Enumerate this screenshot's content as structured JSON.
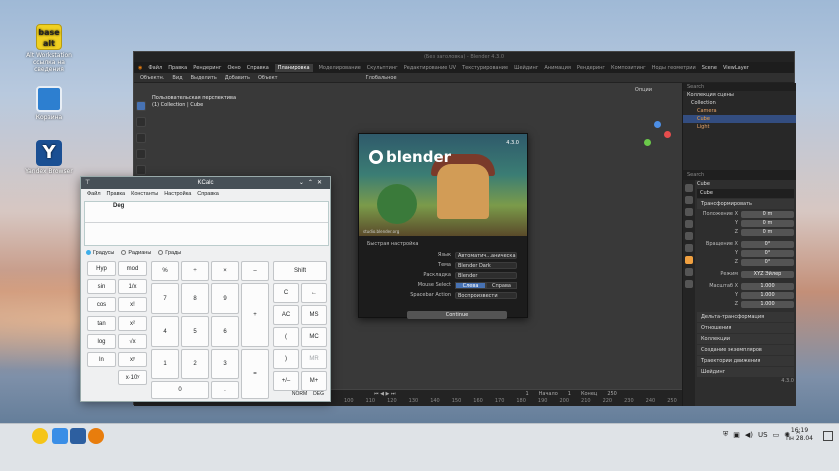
{
  "desktop": {
    "icons": [
      {
        "label": "Alt Workstation\nссылка на\nсведения",
        "badge": "base alt"
      },
      {
        "label": "Корзина"
      },
      {
        "label": "Yandex Browser"
      }
    ]
  },
  "blender": {
    "title": "(Без заголовка) - Blender 4.3.0",
    "menu": [
      "Файл",
      "Правка",
      "Рендеринг",
      "Окно",
      "Справка"
    ],
    "workspaces": [
      "Планировка",
      "Моделирование",
      "Скульптинг",
      "Редактирование UV",
      "Текстурирование",
      "Шейдинг",
      "Анимация",
      "Рендеринг",
      "Композитинг",
      "Ноды геометрии"
    ],
    "active_workspace": "Планировка",
    "scene_label": "Scene",
    "viewlayer_label": "ViewLayer",
    "toolbar": [
      "Объектн.",
      "Вид",
      "Выделить",
      "Добавить",
      "Объект"
    ],
    "transform_label": "Глобальное",
    "options_label": "Опции",
    "viewport_info": [
      "Пользовательская перспектива",
      "(1) Collection | Cube"
    ],
    "outliner": {
      "search_placeholder": "Search",
      "rows": [
        "Коллекция сцены",
        "Collection",
        "Camera",
        "Cube",
        "Light"
      ]
    },
    "properties": {
      "search_placeholder": "Search",
      "object_name": "Cube",
      "object_tab": "Cube",
      "transform_section": "Трансформировать",
      "location_label": "Положение X",
      "location": [
        "0 m",
        "0 m",
        "0 m"
      ],
      "rotation_label": "Вращение X",
      "rotation": [
        "0°",
        "0°",
        "0°"
      ],
      "mode_label": "Режим",
      "mode_value": "XYZ Эйлер",
      "scale_label": "Масштаб X",
      "scale": [
        "1.000",
        "1.000",
        "1.000"
      ],
      "axis_y": "Y",
      "axis_z": "Z",
      "sections": [
        "Дельта-трансформация",
        "Отношения",
        "Коллекции",
        "Создание экземпляров",
        "Траектории движения",
        "Шейдинг"
      ],
      "status_version": "4.3.0"
    },
    "timeline": {
      "frame": "1",
      "start_label": "Начало",
      "start": "1",
      "end_label": "Конец",
      "end": "250",
      "ticks": [
        "100",
        "110",
        "120",
        "130",
        "140",
        "150",
        "160",
        "170",
        "180",
        "190",
        "200",
        "210",
        "220",
        "230",
        "240",
        "250"
      ]
    }
  },
  "splash": {
    "brand": "blender",
    "version": "4.3.0",
    "credit": "studio.blender.org",
    "quick_setup_title": "Быстрая настройка",
    "settings": [
      {
        "label": "Язык",
        "value": "Автоматич...аническая)"
      },
      {
        "label": "Тема",
        "value": "Blender Dark"
      },
      {
        "label": "Раскладка",
        "value": "Blender"
      }
    ],
    "mouse_select_label": "Mouse Select",
    "mouse_select_options": [
      "Слева",
      "Справа"
    ],
    "spacebar_label": "Spacebar Action",
    "spacebar_value": "Воспроизвести",
    "continue_label": "Continue"
  },
  "kcalc": {
    "title": "KCalc",
    "menu": [
      "Файл",
      "Правка",
      "Константы",
      "Настройка",
      "Справка"
    ],
    "display_mode": "Deg",
    "angle_modes": [
      "Градусы",
      "Радианы",
      "Грады"
    ],
    "selected_mode": "Градусы",
    "buttons": {
      "hyp": "Hyp",
      "mod": "mod",
      "pct": "%",
      "div": "÷",
      "mul": "×",
      "minus": "–",
      "shift": "Shift",
      "sin": "sin",
      "inv": "1/x",
      "c": "C",
      "back": "←",
      "cos": "cos",
      "fact": "x!",
      "n7": "7",
      "n8": "8",
      "n9": "9",
      "plus": "+",
      "ac": "AC",
      "ms": "MS",
      "tan": "tan",
      "sq": "x²",
      "n4": "4",
      "n5": "5",
      "n6": "6",
      "lpar": "(",
      "mc": "MC",
      "log": "log",
      "sqrt": "√x",
      "n1": "1",
      "n2": "2",
      "n3": "3",
      "eq": "=",
      "rpar": ")",
      "mr": "MR",
      "ln": "ln",
      "pow": "xʸ",
      "exp": "x·10ʸ",
      "n0": "0",
      "dot": ".",
      "neg": "+/–",
      "mplus": "M+"
    },
    "status": [
      "NORM",
      "DEG"
    ]
  },
  "taskbar": {
    "tray": [
      "US"
    ],
    "time": "16:19",
    "date": "пн 28.04"
  }
}
